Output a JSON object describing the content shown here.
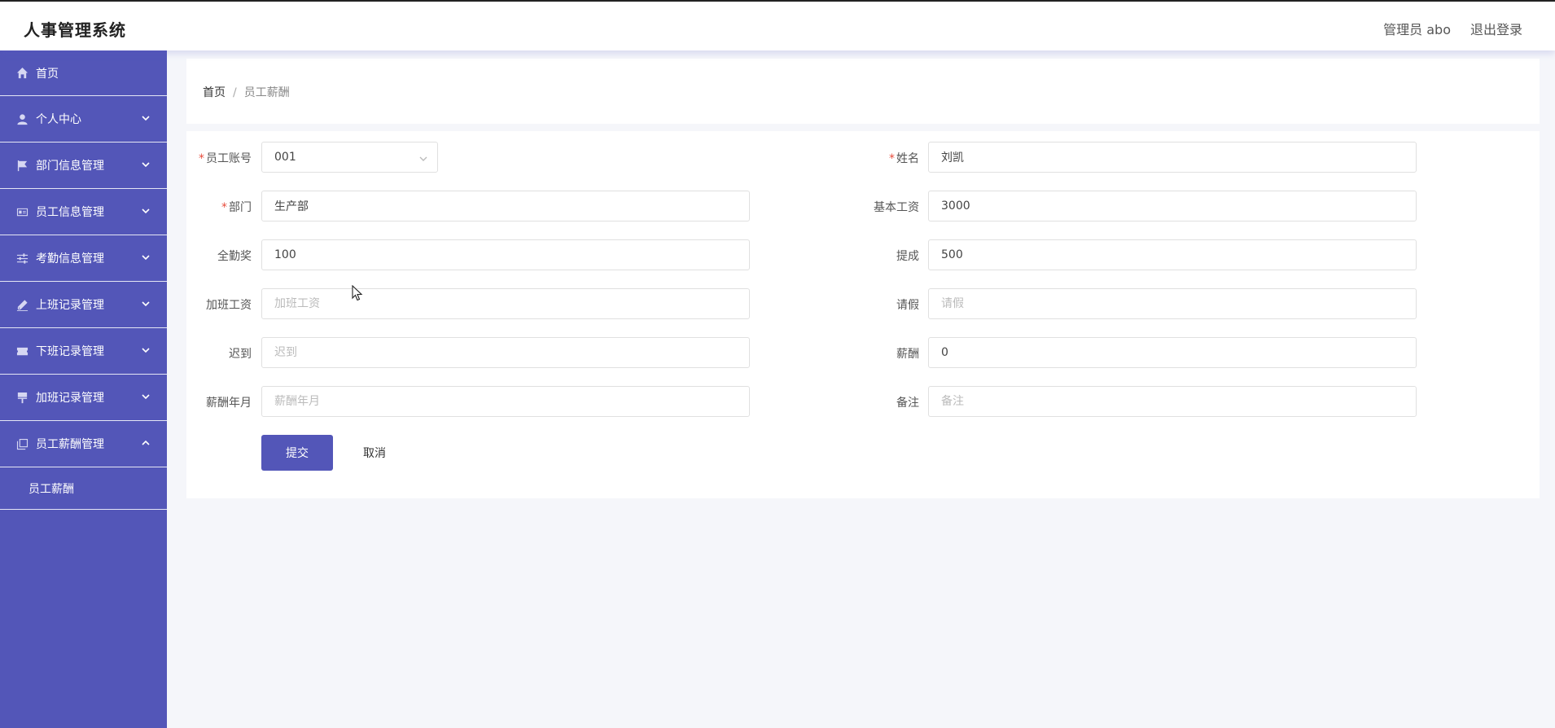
{
  "app": {
    "title": "人事管理系统"
  },
  "header": {
    "user_label": "管理员 abo",
    "logout_label": "退出登录"
  },
  "sidebar": {
    "items": [
      {
        "label": "首页",
        "icon": "home-icon"
      },
      {
        "label": "个人中心",
        "icon": "user-icon"
      },
      {
        "label": "部门信息管理",
        "icon": "flag-icon"
      },
      {
        "label": "员工信息管理",
        "icon": "id-card-icon"
      },
      {
        "label": "考勤信息管理",
        "icon": "sliders-icon"
      },
      {
        "label": "上班记录管理",
        "icon": "pen-icon"
      },
      {
        "label": "下班记录管理",
        "icon": "ticket-icon"
      },
      {
        "label": "加班记录管理",
        "icon": "brush-icon"
      },
      {
        "label": "员工薪酬管理",
        "icon": "copy-icon"
      }
    ],
    "submenu": {
      "label": "员工薪酬"
    }
  },
  "breadcrumb": {
    "home": "首页",
    "separator": "/",
    "current": "员工薪酬"
  },
  "form": {
    "employee_account": {
      "label": "员工账号",
      "value": "001"
    },
    "name": {
      "label": "姓名",
      "value": "刘凯"
    },
    "department": {
      "label": "部门",
      "value": "生产部"
    },
    "base_salary": {
      "label": "基本工资",
      "value": "3000"
    },
    "attendance_bonus": {
      "label": "全勤奖",
      "value": "100"
    },
    "commission": {
      "label": "提成",
      "value": "500"
    },
    "overtime_pay": {
      "label": "加班工资",
      "placeholder": "加班工资"
    },
    "leave": {
      "label": "请假",
      "placeholder": "请假"
    },
    "late": {
      "label": "迟到",
      "placeholder": "迟到"
    },
    "salary": {
      "label": "薪酬",
      "value": "0"
    },
    "salary_month": {
      "label": "薪酬年月",
      "placeholder": "薪酬年月"
    },
    "remark": {
      "label": "备注",
      "placeholder": "备注"
    },
    "required_mark": "*",
    "submit_label": "提交",
    "cancel_label": "取消"
  },
  "colors": {
    "primary": "#5356b8",
    "required": "#e74c3c"
  }
}
